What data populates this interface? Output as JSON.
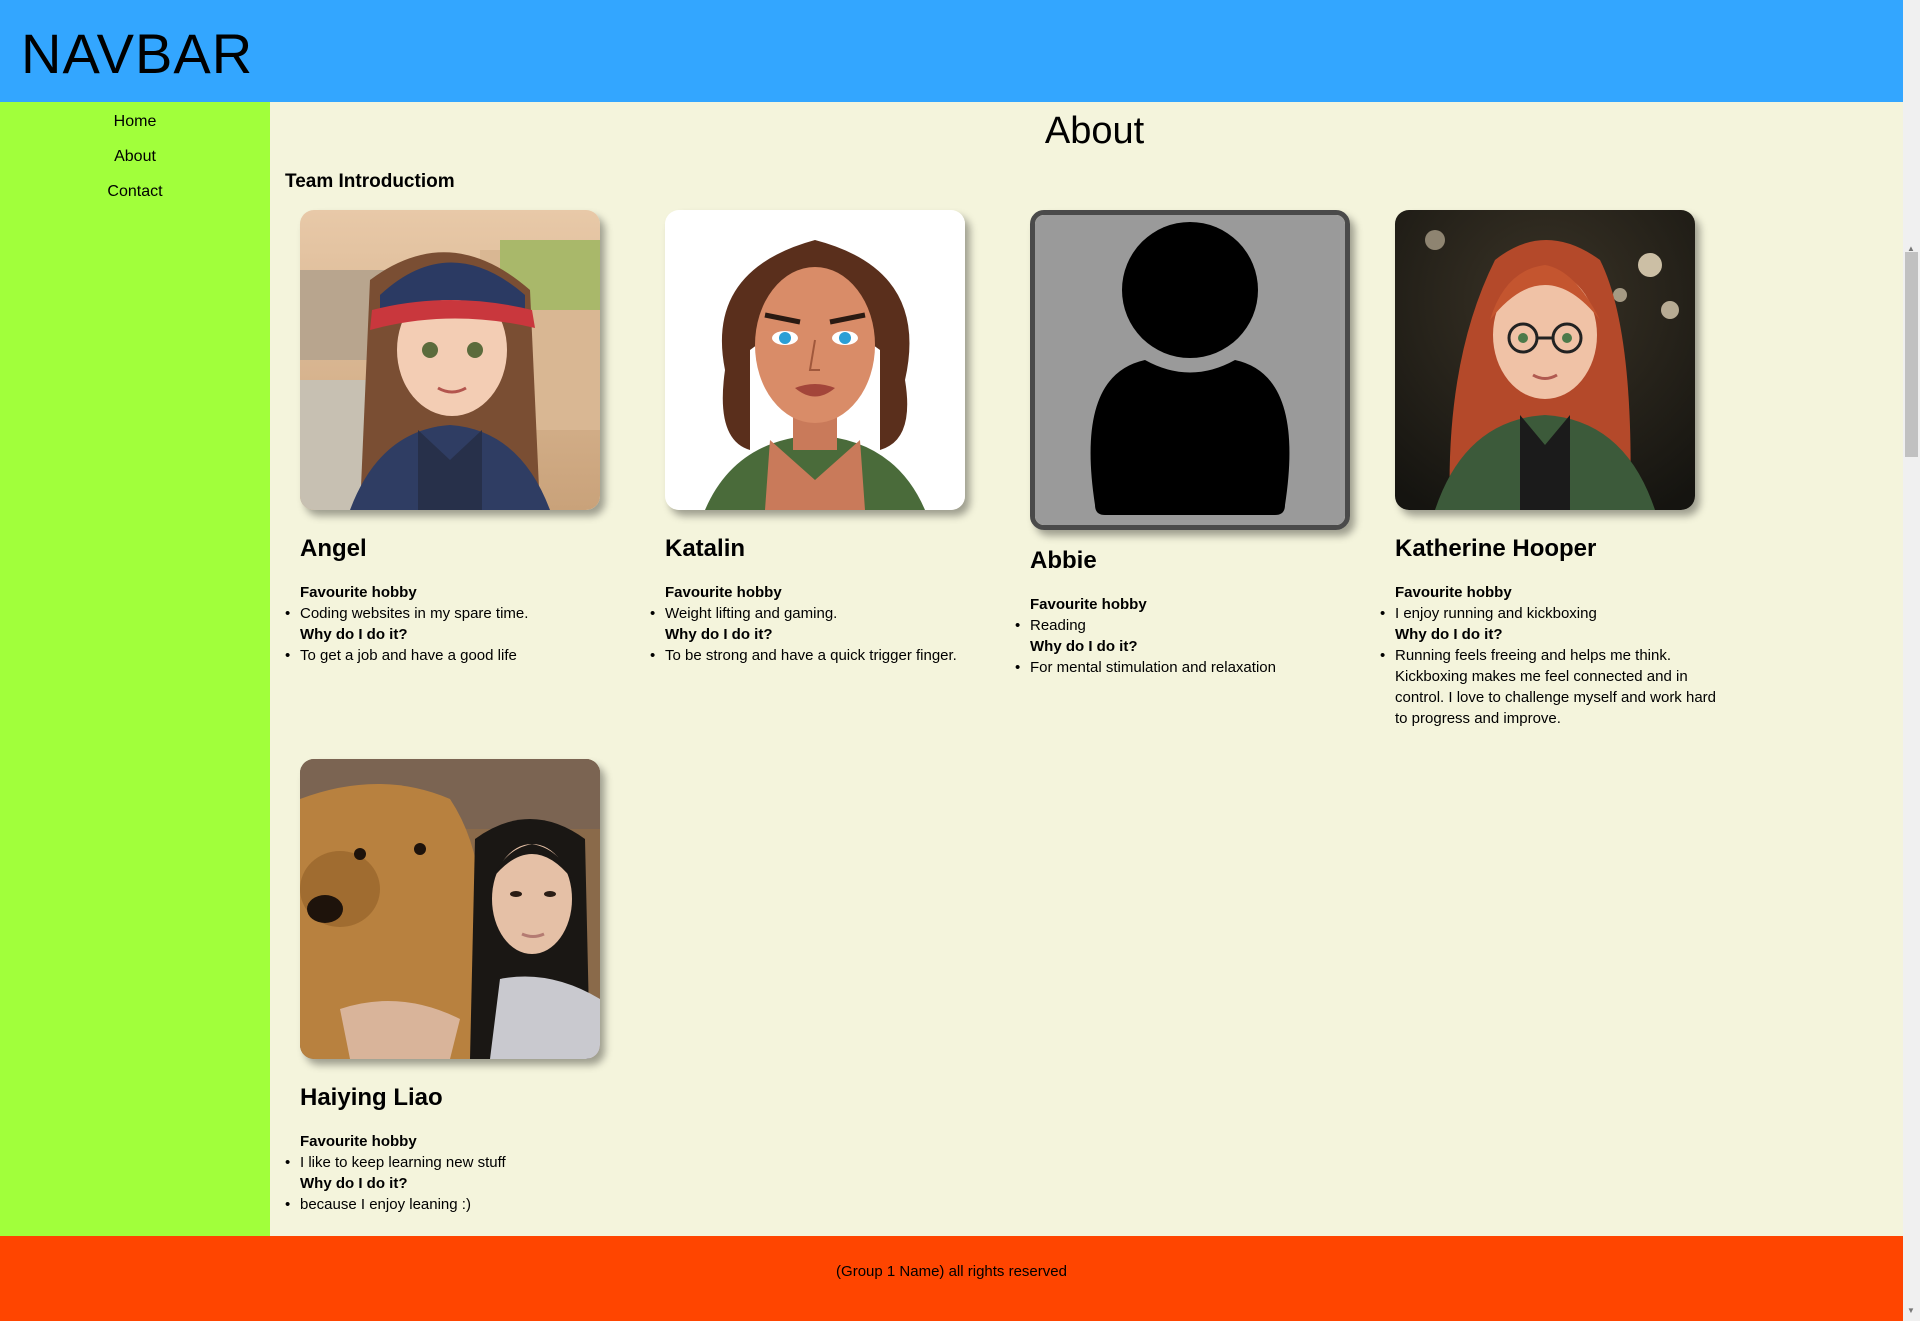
{
  "navbar": {
    "brand": "NAVBAR"
  },
  "sidebar": {
    "items": [
      {
        "label": "Home"
      },
      {
        "label": "About"
      },
      {
        "label": "Contact"
      }
    ]
  },
  "main": {
    "title": "About",
    "section_title": "Team Introductiom",
    "members": [
      {
        "name": "Angel",
        "hobby_label": "Favourite hobby",
        "hobby": "Coding websites in my spare time.",
        "why_label": "Why do I do it?",
        "why": "To get a job and have a good life"
      },
      {
        "name": "Katalin",
        "hobby_label": "Favourite hobby",
        "hobby": "Weight lifting and gaming.",
        "why_label": "Why do I do it?",
        "why": "To be strong and have a quick trigger finger."
      },
      {
        "name": "Abbie",
        "hobby_label": "Favourite hobby",
        "hobby": "Reading",
        "why_label": "Why do I do it?",
        "why": "For mental stimulation and relaxation"
      },
      {
        "name": "Katherine Hooper",
        "hobby_label": "Favourite hobby",
        "hobby": "I enjoy running and kickboxing",
        "why_label": "Why do I do it?",
        "why": "Running feels freeing and helps me think. Kickboxing makes me feel connected and in control. I love to challenge myself and work hard to progress and improve."
      },
      {
        "name": "Haiying Liao",
        "hobby_label": "Favourite hobby",
        "hobby": "I like to keep learning new stuff",
        "why_label": "Why do I do it?",
        "why": "because I enjoy leaning :)"
      }
    ]
  },
  "footer": {
    "text": "(Group 1 Name) all rights reserved"
  },
  "colors": {
    "navbar": "#33a6ff",
    "sidebar": "#a1ff3b",
    "main": "#f4f4dc",
    "footer": "#ff4500"
  }
}
